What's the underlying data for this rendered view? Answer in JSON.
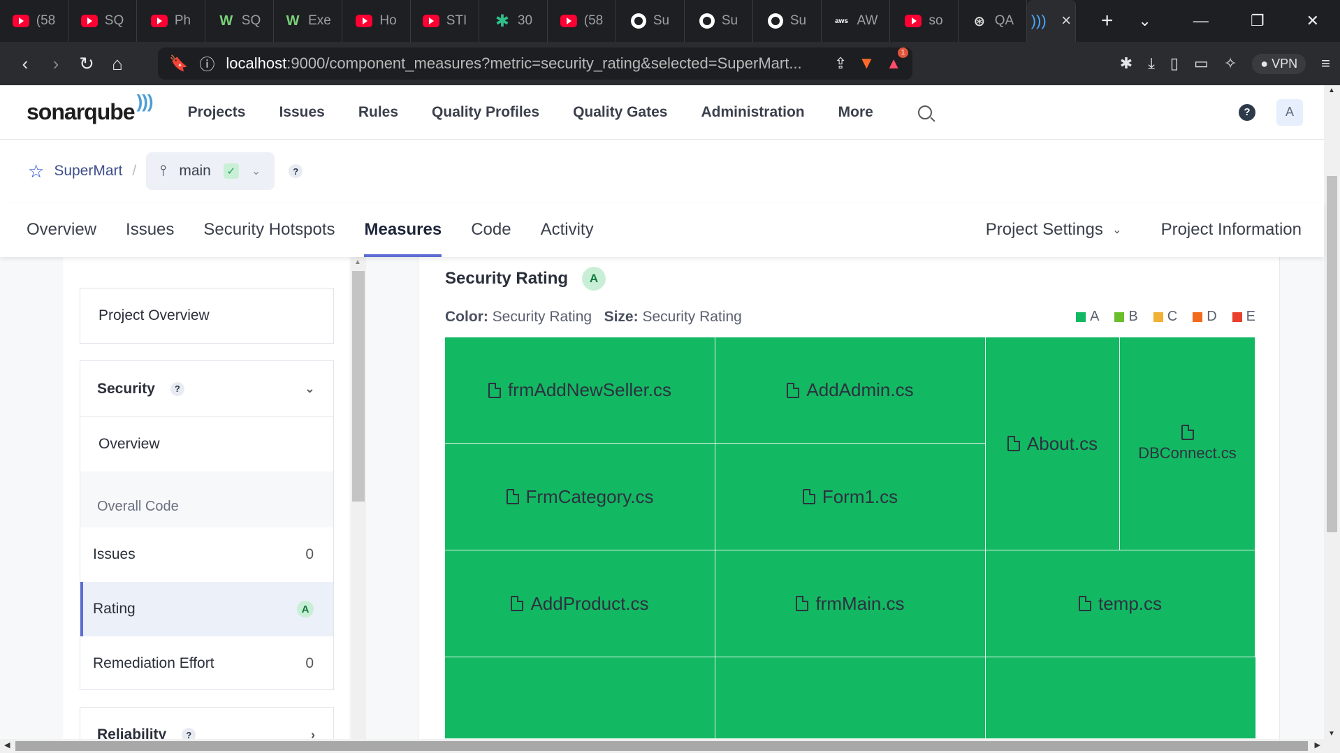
{
  "browser": {
    "tabs": [
      {
        "icon": "youtube-icon",
        "kind": "yt",
        "title": "(58"
      },
      {
        "icon": "youtube-icon",
        "kind": "yt",
        "title": "SQ"
      },
      {
        "icon": "youtube-icon",
        "kind": "yt",
        "title": "Ph"
      },
      {
        "icon": "w3schools-icon",
        "kind": "w",
        "title": "SQ"
      },
      {
        "icon": "w3schools-icon",
        "kind": "w",
        "title": "Exe"
      },
      {
        "icon": "youtube-icon",
        "kind": "yt",
        "title": "Ho"
      },
      {
        "icon": "youtube-icon",
        "kind": "yt",
        "title": "STI"
      },
      {
        "icon": "gear-badge-icon",
        "kind": "gear",
        "title": "30"
      },
      {
        "icon": "youtube-icon",
        "kind": "yt",
        "title": "(58"
      },
      {
        "icon": "github-icon",
        "kind": "gh",
        "title": "Su"
      },
      {
        "icon": "github-icon",
        "kind": "gh",
        "title": "Su"
      },
      {
        "icon": "github-icon",
        "kind": "gh",
        "title": "Su"
      },
      {
        "icon": "aws-icon",
        "kind": "aws",
        "title": "AW"
      },
      {
        "icon": "youtube-icon",
        "kind": "yt",
        "title": "so"
      },
      {
        "icon": "chatgpt-icon",
        "kind": "gpt",
        "title": "QA"
      }
    ],
    "url_host": "localhost",
    "url_rest": ":9000/component_measures?metric=security_rating&selected=SuperMart...",
    "vpn_label": "VPN",
    "bat_badge": "1"
  },
  "header": {
    "logo": "sonarqube",
    "nav": [
      "Projects",
      "Issues",
      "Rules",
      "Quality Profiles",
      "Quality Gates",
      "Administration",
      "More"
    ],
    "help": "?",
    "avatar": "A"
  },
  "breadcrumb": {
    "project": "SuperMart",
    "separator": "/",
    "branch": "main",
    "help": "?"
  },
  "project_tabs": {
    "left": [
      "Overview",
      "Issues",
      "Security Hotspots",
      "Measures",
      "Code",
      "Activity"
    ],
    "active": "Measures",
    "settings": "Project Settings",
    "information": "Project Information"
  },
  "sidebar": {
    "project_overview": "Project Overview",
    "security": {
      "title": "Security",
      "help": "?",
      "overview": "Overview",
      "overall_code": "Overall Code",
      "metrics": [
        {
          "label": "Issues",
          "value": "0"
        },
        {
          "label": "Rating",
          "value": "A"
        },
        {
          "label": "Remediation Effort",
          "value": "0"
        }
      ]
    },
    "reliability": {
      "title": "Reliability",
      "help": "?"
    }
  },
  "main": {
    "title": "Security Rating",
    "rating": "A",
    "color_label": "Color:",
    "color_value": "Security Rating",
    "size_label": "Size:",
    "size_value": "Security Rating",
    "legend": [
      {
        "label": "A",
        "color": "#13b862"
      },
      {
        "label": "B",
        "color": "#6bbf2c"
      },
      {
        "label": "C",
        "color": "#f2b134"
      },
      {
        "label": "D",
        "color": "#f26a1b"
      },
      {
        "label": "E",
        "color": "#e8402c"
      }
    ],
    "treemap_files": [
      "frmAddNewSeller.cs",
      "AddAdmin.cs",
      "About.cs",
      "DBConnect.cs",
      "FrmCategory.cs",
      "Form1.cs",
      "AddProduct.cs",
      "frmMain.cs",
      "temp.cs"
    ],
    "treemap_color": "#13b862"
  }
}
